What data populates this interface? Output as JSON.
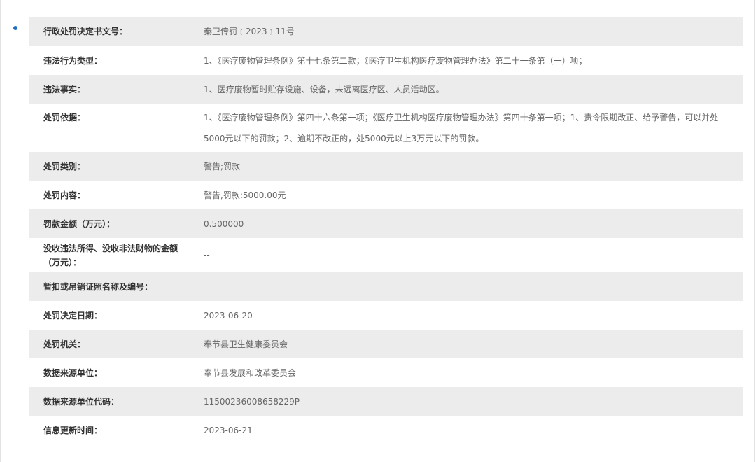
{
  "rows": [
    {
      "label": "行政处罚决定书文号：",
      "value": "秦卫传罚﹝2023﹞11号"
    },
    {
      "label": "违法行为类型：",
      "value": "1、《医疗废物管理条例》第十七条第二款；《医疗卫生机构医疗废物管理办法》第二十一条第（一）项；"
    },
    {
      "label": "违法事实：",
      "value": "1、医疗废物暂时贮存设施、设备，未远离医疗区、人员活动区。"
    },
    {
      "label": "处罚依据：",
      "value": "1、《医疗废物管理条例》第四十六条第一项；《医疗卫生机构医疗废物管理办法》第四十条第一项；1、责令限期改正、给予警告，可以并处5000元以下的罚款；2、逾期不改正的，处5000元以上3万元以下的罚款。"
    },
    {
      "label": "处罚类别：",
      "value": "警告;罚款"
    },
    {
      "label": "处罚内容：",
      "value": "警告,罚款:5000.00元"
    },
    {
      "label": "罚款金额（万元）：",
      "value": "0.500000"
    },
    {
      "label": "没收违法所得、没收非法财物的金额（万元）：",
      "value": "--"
    },
    {
      "label": "暂扣或吊销证照名称及编号：",
      "value": ""
    },
    {
      "label": "处罚决定日期：",
      "value": "2023-06-20"
    },
    {
      "label": "处罚机关：",
      "value": "奉节县卫生健康委员会"
    },
    {
      "label": "数据来源单位：",
      "value": "奉节县发展和改革委员会"
    },
    {
      "label": "数据来源单位代码：",
      "value": "11500236008658229P"
    },
    {
      "label": "信息更新时间：",
      "value": "2023-06-21"
    }
  ]
}
